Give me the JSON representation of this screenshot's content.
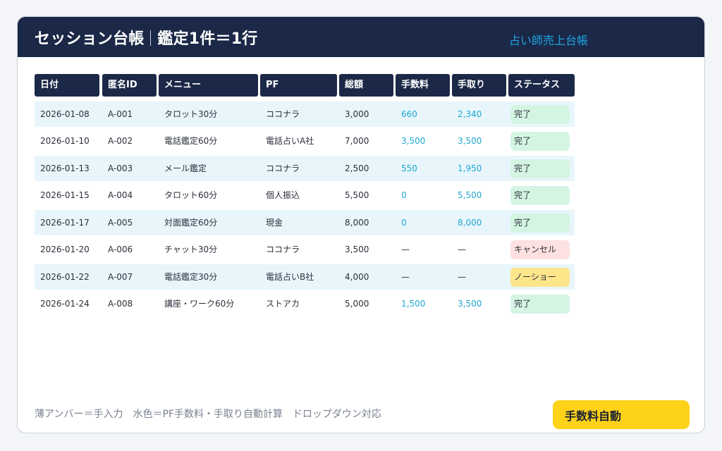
{
  "header": {
    "title_main": "セッション台帳",
    "title_sub": "鑑定1件＝1行",
    "link_label": "占い師売上台帳"
  },
  "table": {
    "columns": [
      "日付",
      "匿名ID",
      "メニュー",
      "PF",
      "総額",
      "手数料",
      "手取り",
      "ステータス"
    ],
    "rows": [
      {
        "date": "2026-01-08",
        "id": "A-001",
        "menu": "タロット30分",
        "pf": "ココナラ",
        "total": "3,000",
        "fee": "660",
        "net": "2,340",
        "status": "完了",
        "status_type": "done"
      },
      {
        "date": "2026-01-10",
        "id": "A-002",
        "menu": "電話鑑定60分",
        "pf": "電話占いA社",
        "total": "7,000",
        "fee": "3,500",
        "net": "3,500",
        "status": "完了",
        "status_type": "done"
      },
      {
        "date": "2026-01-13",
        "id": "A-003",
        "menu": "メール鑑定",
        "pf": "ココナラ",
        "total": "2,500",
        "fee": "550",
        "net": "1,950",
        "status": "完了",
        "status_type": "done"
      },
      {
        "date": "2026-01-15",
        "id": "A-004",
        "menu": "タロット60分",
        "pf": "個人振込",
        "total": "5,500",
        "fee": "0",
        "net": "5,500",
        "status": "完了",
        "status_type": "done"
      },
      {
        "date": "2026-01-17",
        "id": "A-005",
        "menu": "対面鑑定60分",
        "pf": "現金",
        "total": "8,000",
        "fee": "0",
        "net": "8,000",
        "status": "完了",
        "status_type": "done"
      },
      {
        "date": "2026-01-20",
        "id": "A-006",
        "menu": "チャット30分",
        "pf": "ココナラ",
        "total": "3,500",
        "fee": "—",
        "net": "—",
        "status": "キャンセル",
        "status_type": "cancel"
      },
      {
        "date": "2026-01-22",
        "id": "A-007",
        "menu": "電話鑑定30分",
        "pf": "電話占いB社",
        "total": "4,000",
        "fee": "—",
        "net": "—",
        "status": "ノーショー",
        "status_type": "noshow"
      },
      {
        "date": "2026-01-24",
        "id": "A-008",
        "menu": "講座・ワーク60分",
        "pf": "ストアカ",
        "total": "5,000",
        "fee": "1,500",
        "net": "3,500",
        "status": "完了",
        "status_type": "done"
      }
    ]
  },
  "legend": "薄アンバー＝手入力　水色＝PF手数料・手取り自動計算　ドロップダウン対応",
  "cta_label": "手数料自動",
  "colors": {
    "header_bg": "#1b2847",
    "link": "#1fa3e0",
    "row_alt": "#e8f6fc",
    "calc_text": "#1fa7cf",
    "status_done": "#d5f5e3",
    "status_cancel": "#fde0e0",
    "status_noshow": "#fde58a",
    "cta_bg": "#ffd21a"
  }
}
